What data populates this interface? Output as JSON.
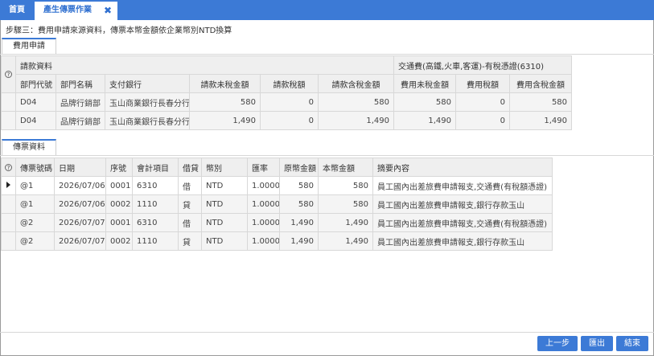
{
  "tabs": {
    "home": "首頁",
    "active": "產生傳票作業",
    "close_glyph": "✖"
  },
  "step_title": "步驟三：費用申請來源資料，傳票本幣金額依企業幣別NTD換算",
  "request_section": {
    "tab_label": "費用申請",
    "group_left": "請款資料",
    "group_right": "交通費(高鐵,火車,客運)-有稅憑證(6310)",
    "columns": [
      "部門代號",
      "部門名稱",
      "支付銀行",
      "請款未稅金額",
      "請款稅額",
      "請款含稅金額",
      "費用未稅金額",
      "費用稅額",
      "費用含稅金額"
    ],
    "rows": [
      [
        "D04",
        "品牌行銷部",
        "玉山商業銀行長春分行",
        "580",
        "0",
        "580",
        "580",
        "0",
        "580"
      ],
      [
        "D04",
        "品牌行銷部",
        "玉山商業銀行長春分行",
        "1,490",
        "0",
        "1,490",
        "1,490",
        "0",
        "1,490"
      ]
    ]
  },
  "voucher_section": {
    "tab_label": "傳票資料",
    "columns": [
      "傳票號碼",
      "日期",
      "序號",
      "會計項目",
      "借貸",
      "幣別",
      "匯率",
      "原幣金額",
      "本幣金額",
      "摘要內容"
    ],
    "rows": [
      [
        "@1",
        "2026/07/06",
        "0001",
        "6310",
        "借",
        "NTD",
        "1.0000",
        "580",
        "580",
        "員工國內出差旅費申請報支,交通費(有稅額憑證)"
      ],
      [
        "@1",
        "2026/07/06",
        "0002",
        "1110",
        "貸",
        "NTD",
        "1.0000",
        "580",
        "580",
        "員工國內出差旅費申請報支,銀行存款玉山"
      ],
      [
        "@2",
        "2026/07/07",
        "0001",
        "6310",
        "借",
        "NTD",
        "1.0000",
        "1,490",
        "1,490",
        "員工國內出差旅費申請報支,交通費(有稅額憑證)"
      ],
      [
        "@2",
        "2026/07/07",
        "0002",
        "1110",
        "貸",
        "NTD",
        "1.0000",
        "1,490",
        "1,490",
        "員工國內出差旅費申請報支,銀行存款玉山"
      ]
    ]
  },
  "buttons": {
    "prev": "上一步",
    "export": "匯出",
    "finish": "結束"
  },
  "colors": {
    "accent": "#3c7ad6"
  }
}
